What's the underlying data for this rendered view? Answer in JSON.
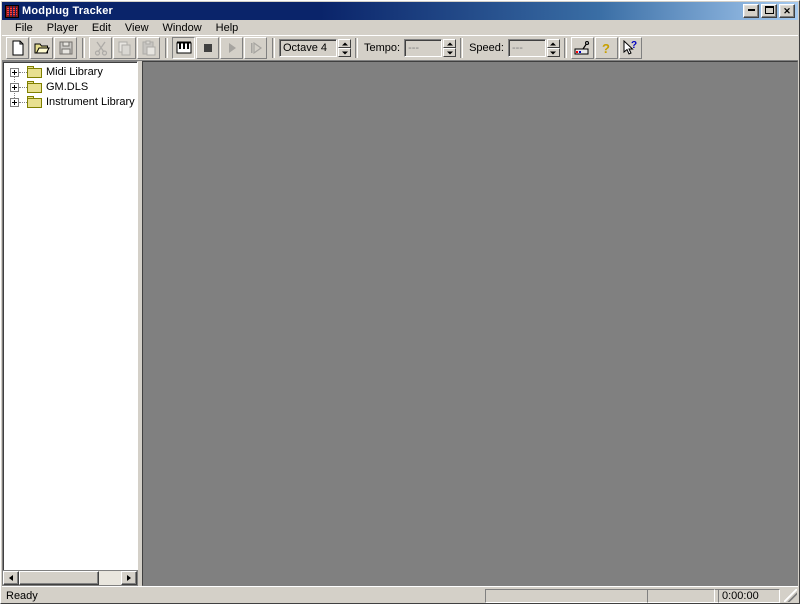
{
  "window": {
    "title": "Modplug Tracker",
    "icon": "modplug-app-icon",
    "buttons": [
      {
        "name": "minimize-button",
        "label": "_"
      },
      {
        "name": "maximize-button",
        "label": "□"
      },
      {
        "name": "close-button",
        "label": "✕"
      }
    ]
  },
  "menubar": {
    "items": [
      {
        "label": "File"
      },
      {
        "label": "Player"
      },
      {
        "label": "Edit"
      },
      {
        "label": "View"
      },
      {
        "label": "Window"
      },
      {
        "label": "Help"
      }
    ]
  },
  "toolbar": {
    "buttons": [
      {
        "name": "new-button",
        "icon": "new-document-icon",
        "enabled": true
      },
      {
        "name": "open-button",
        "icon": "open-folder-icon",
        "enabled": true
      },
      {
        "name": "save-button",
        "icon": "floppy-save-icon",
        "enabled": false
      },
      {
        "name": "cut-button",
        "icon": "scissors-icon",
        "enabled": false
      },
      {
        "name": "copy-button",
        "icon": "copy-icon",
        "enabled": false
      },
      {
        "name": "paste-button",
        "icon": "clipboard-paste-icon",
        "enabled": false
      },
      {
        "name": "midi-record-button",
        "icon": "piano-keys-icon",
        "enabled": true,
        "pressed": true
      },
      {
        "name": "stop-button",
        "icon": "stop-square-icon",
        "enabled": true
      },
      {
        "name": "play-button",
        "icon": "play-triangle-icon",
        "enabled": false
      },
      {
        "name": "play-pattern-button",
        "icon": "play-from-start-icon",
        "enabled": false
      },
      {
        "name": "midi-setup-button",
        "icon": "midi-plug-icon",
        "enabled": true
      },
      {
        "name": "help-button",
        "icon": "question-mark-icon",
        "enabled": true
      },
      {
        "name": "context-help-button",
        "icon": "arrow-question-icon",
        "enabled": true
      }
    ],
    "octave": {
      "label": "",
      "value": "Octave 4"
    },
    "tempo": {
      "label": "Tempo:",
      "value": "---"
    },
    "speed": {
      "label": "Speed:",
      "value": "---"
    }
  },
  "tree": {
    "items": [
      {
        "label": "Midi Library",
        "expander": "plus",
        "icon": "folder-icon"
      },
      {
        "label": "GM.DLS",
        "expander": "plus",
        "icon": "folder-icon"
      },
      {
        "label": "Instrument Library (D:\\MI",
        "expander": "plus",
        "icon": "folder-icon"
      }
    ]
  },
  "scrollbar": {
    "left_arrow": "scroll-left-arrow",
    "right_arrow": "scroll-right-arrow"
  },
  "statusbar": {
    "message": "Ready",
    "panes": [
      {
        "name": "status-pane-info",
        "value": ""
      },
      {
        "name": "status-pane-mode",
        "value": ""
      },
      {
        "name": "status-pane-time",
        "value": "0:00:00"
      }
    ]
  }
}
